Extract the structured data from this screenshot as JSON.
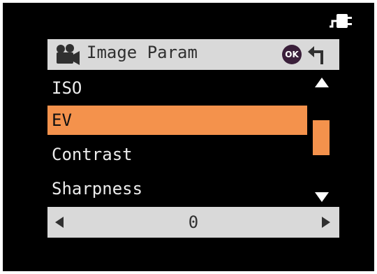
{
  "header": {
    "title": "Image Param",
    "ok_label": "OK"
  },
  "menu": {
    "items": [
      {
        "label": "ISO",
        "selected": false
      },
      {
        "label": "EV",
        "selected": true
      },
      {
        "label": "Contrast",
        "selected": false
      },
      {
        "label": "Sharpness",
        "selected": false
      }
    ]
  },
  "value_bar": {
    "value": "0"
  },
  "colors": {
    "screen_bg": "#000000",
    "bar_bg": "#d9d9d9",
    "highlight": "#f4924c",
    "text_light": "#ececec",
    "text_dark": "#303030"
  },
  "icons": [
    "power-plug-icon",
    "video-camera-icon",
    "ok-icon",
    "back-icon",
    "scroll-up-icon",
    "scroll-down-icon",
    "arrow-left-icon",
    "arrow-right-icon"
  ]
}
